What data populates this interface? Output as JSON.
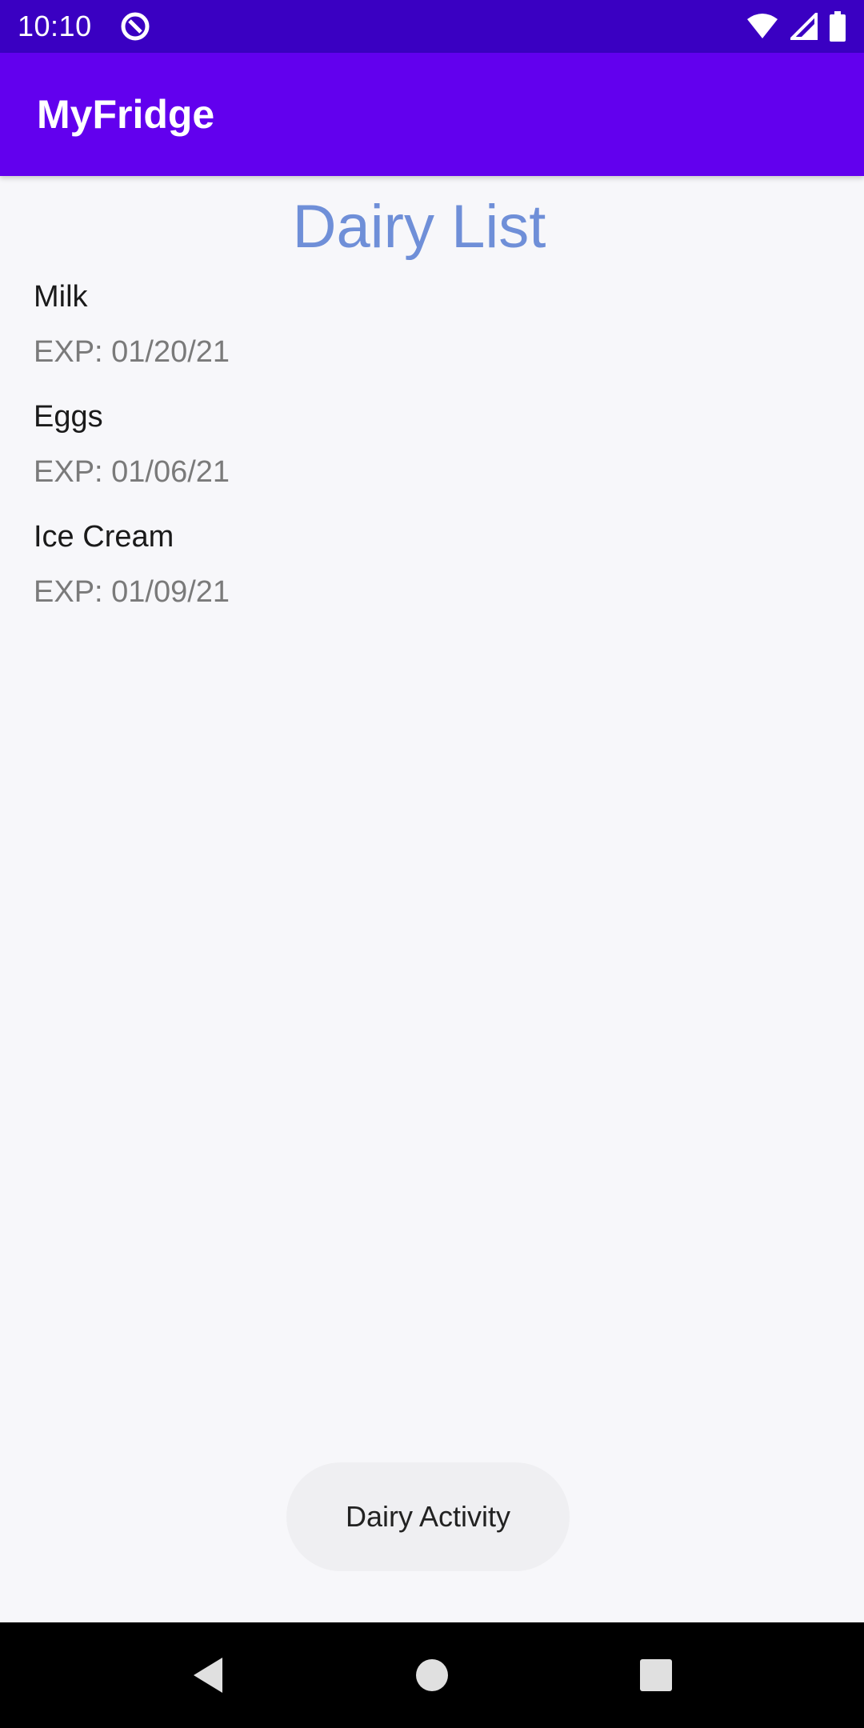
{
  "status_bar": {
    "time": "10:10",
    "icons": [
      "app-notification-icon",
      "wifi-icon",
      "cellular-signal-icon",
      "battery-icon"
    ]
  },
  "app_bar": {
    "title": "MyFridge"
  },
  "page": {
    "title": "Dairy List"
  },
  "items": [
    {
      "name": "Milk",
      "exp": "EXP: 01/20/21"
    },
    {
      "name": "Eggs",
      "exp": "EXP: 01/06/21"
    },
    {
      "name": "Ice Cream",
      "exp": "EXP: 01/09/21"
    }
  ],
  "toast": {
    "text": "Dairy Activity"
  },
  "nav_bar": {
    "icons": [
      "back-icon",
      "home-icon",
      "recents-icon"
    ]
  },
  "colors": {
    "status_bar": "#3a00c2",
    "app_bar": "#6200ee",
    "page_title": "#6f8fd8",
    "background": "#f7f7fa"
  }
}
